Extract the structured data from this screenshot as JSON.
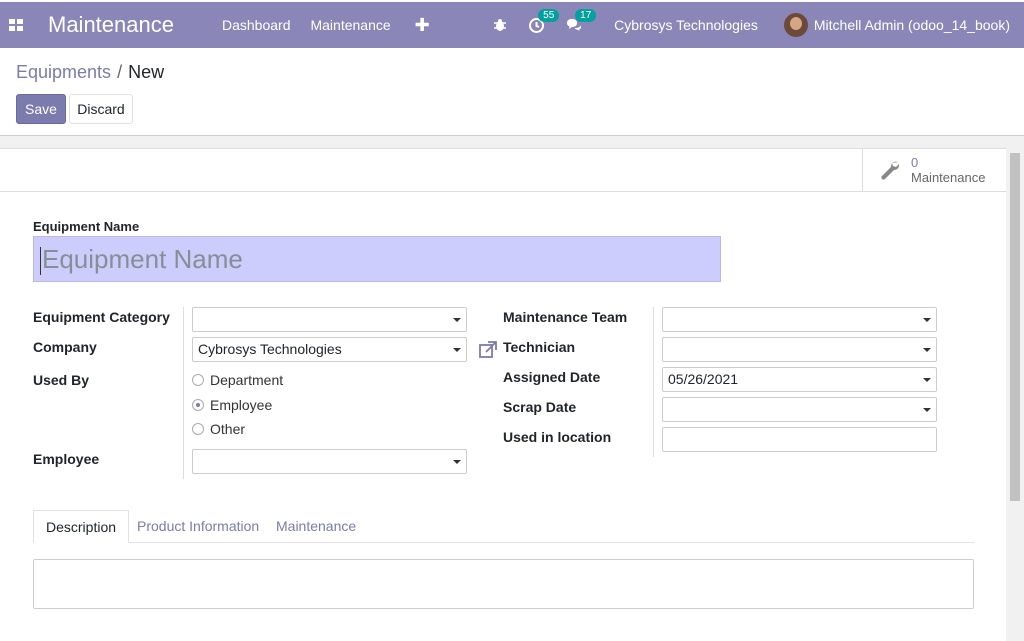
{
  "navbar": {
    "app_title": "Maintenance",
    "menu": [
      "Dashboard",
      "Maintenance"
    ],
    "activity_count": "55",
    "message_count": "17",
    "company": "Cybrosys Technologies",
    "user": "Mitchell Admin (odoo_14_book)"
  },
  "breadcrumb": {
    "parent": "Equipments",
    "separator": "/",
    "current": "New"
  },
  "actions": {
    "save": "Save",
    "discard": "Discard"
  },
  "stat_button": {
    "count": "0",
    "label": "Maintenance"
  },
  "form": {
    "name_label": "Equipment Name",
    "name_placeholder": "Equipment Name",
    "left": {
      "category_label": "Equipment Category",
      "category_value": "",
      "company_label": "Company",
      "company_value": "Cybrosys Technologies",
      "used_by_label": "Used By",
      "used_by_options": [
        "Department",
        "Employee",
        "Other"
      ],
      "used_by_selected": "Employee",
      "employee_label": "Employee",
      "employee_value": ""
    },
    "right": {
      "team_label": "Maintenance Team",
      "team_value": "",
      "technician_label": "Technician",
      "technician_value": "",
      "assigned_date_label": "Assigned Date",
      "assigned_date_value": "05/26/2021",
      "scrap_date_label": "Scrap Date",
      "scrap_date_value": "",
      "location_label": "Used in location",
      "location_value": ""
    }
  },
  "tabs": [
    "Description",
    "Product Information",
    "Maintenance"
  ],
  "active_tab": "Description",
  "colors": {
    "navbar": "#8a86b8",
    "primary": "#7c7bad",
    "title_input_bg": "#cdcdfd",
    "badge": "#00a09d"
  }
}
